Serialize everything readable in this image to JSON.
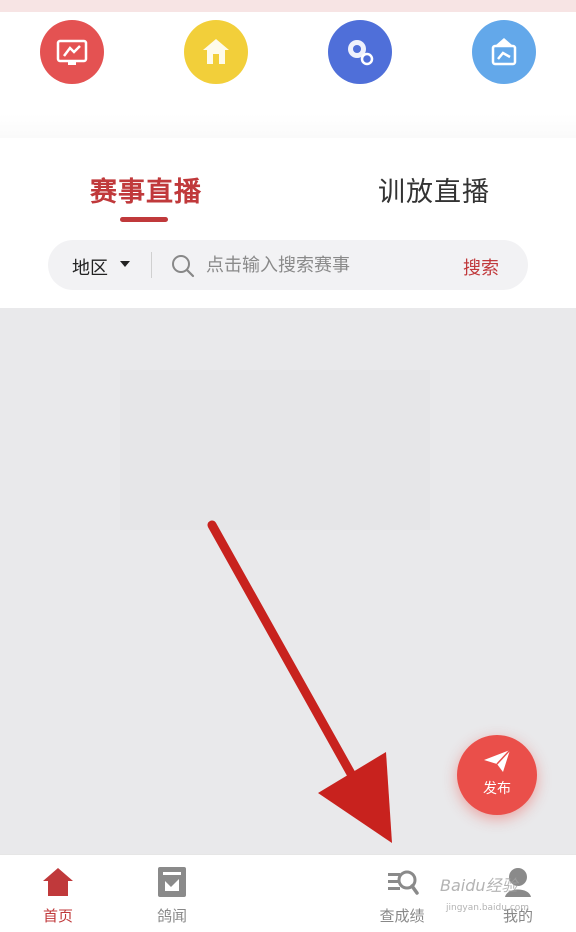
{
  "quick_icons": [
    {
      "name": "pigeon-screen-icon",
      "color": "#e45252"
    },
    {
      "name": "home-icon",
      "color": "#f2cf3a"
    },
    {
      "name": "location-pin-icon",
      "color": "#4f6fd9"
    },
    {
      "name": "pigeon-loft-icon",
      "color": "#63a8ea"
    }
  ],
  "tabs": {
    "race_live": "赛事直播",
    "training_live": "训放直播"
  },
  "search": {
    "region_label": "地区",
    "placeholder": "点击输入搜索赛事",
    "button_label": "搜索"
  },
  "publish": {
    "label": "发布"
  },
  "tabbar": {
    "items": [
      {
        "label": "首页",
        "icon": "home-icon",
        "active": true
      },
      {
        "label": "鸽闻",
        "icon": "news-icon",
        "active": false
      },
      {
        "label": "查成绩",
        "icon": "search-results-icon",
        "active": false
      },
      {
        "label": "我的",
        "icon": "profile-icon",
        "active": false
      }
    ]
  },
  "watermark": {
    "text": "Baidu经验",
    "sub": "jingyan.baidu.com"
  },
  "colors": {
    "accent": "#c0393b",
    "fab": "#ea4f4a",
    "content_bg": "#e9e9eb",
    "annotation_arrow": "#c8221e"
  }
}
